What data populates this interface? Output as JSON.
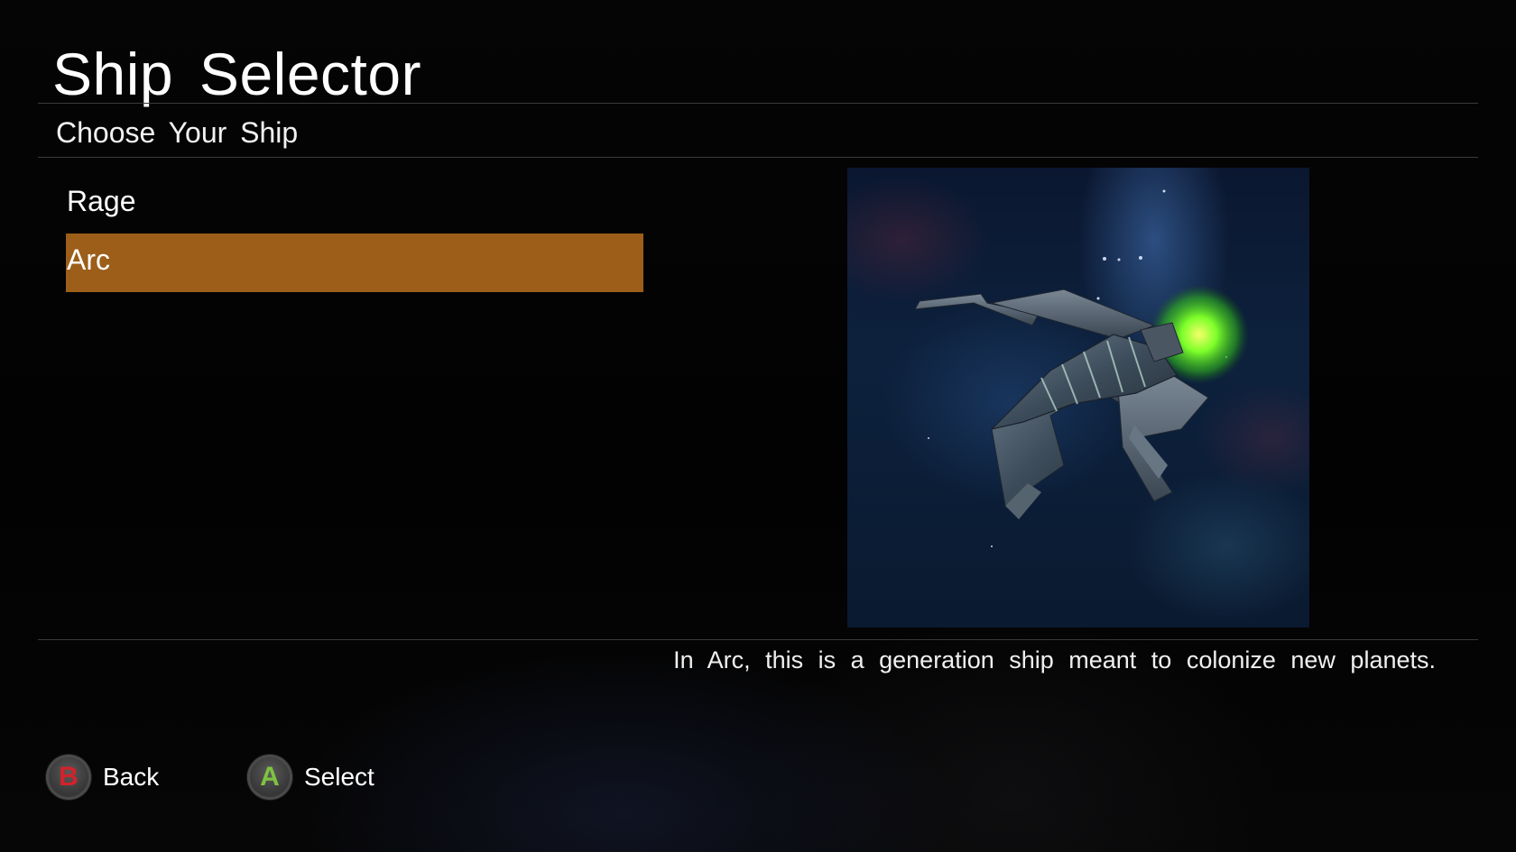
{
  "header": {
    "title": "Ship Selector",
    "subtitle": "Choose Your Ship"
  },
  "ships": [
    {
      "name": "Rage",
      "selected": false
    },
    {
      "name": "Arc",
      "selected": true
    }
  ],
  "selection_color": "#9c5e19",
  "preview": {
    "description": "In Arc, this is a generation ship meant to colonize new planets."
  },
  "controls": {
    "back": {
      "button": "B",
      "label": "Back",
      "button_color": "#d2232a"
    },
    "select": {
      "button": "A",
      "label": "Select",
      "button_color": "#7fc241"
    }
  }
}
